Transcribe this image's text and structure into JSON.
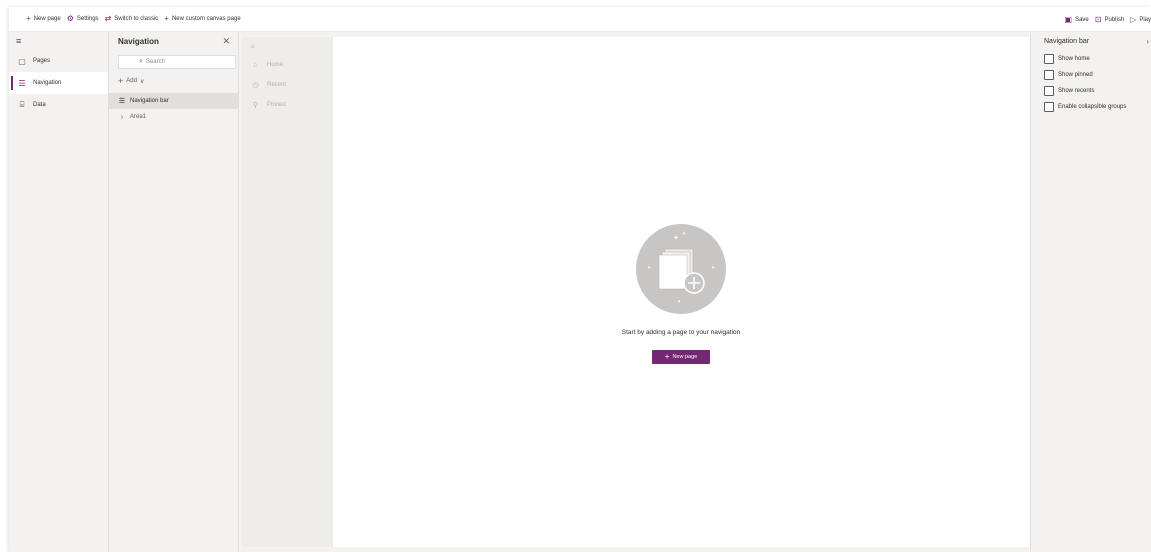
{
  "command_bar": {
    "new_page": "New page",
    "settings": "Settings",
    "switch_to_classic": "Switch to classic",
    "new_custom_canvas_page": "New custom canvas page",
    "save": "Save",
    "publish": "Publish",
    "play": "Play"
  },
  "rail": {
    "items": [
      {
        "label": "Pages",
        "icon": "page-icon"
      },
      {
        "label": "Navigation",
        "icon": "navigation-icon",
        "active": true
      },
      {
        "label": "Data",
        "icon": "database-icon"
      }
    ]
  },
  "nav_panel": {
    "title": "Navigation",
    "search_placeholder": "Search",
    "add_label": "Add",
    "items": [
      {
        "label": "Navigation bar",
        "icon": "list-icon",
        "selected": true
      },
      {
        "label": "Area1",
        "icon": "chevron-right-icon"
      }
    ]
  },
  "preview_nav": {
    "items": [
      {
        "label": "Home",
        "icon": "home-icon"
      },
      {
        "label": "Recent",
        "icon": "clock-icon"
      },
      {
        "label": "Pinned",
        "icon": "pin-icon"
      }
    ]
  },
  "canvas": {
    "empty_message": "Start by adding a page to your navigation",
    "new_page_button": "New page"
  },
  "properties": {
    "title": "Navigation bar",
    "checkboxes": [
      {
        "label": "Show home",
        "checked": false
      },
      {
        "label": "Show pinned",
        "checked": false
      },
      {
        "label": "Show recents",
        "checked": false
      },
      {
        "label": "Enable collapsible groups",
        "checked": false
      }
    ]
  },
  "colors": {
    "accent": "#742774",
    "rail_bg": "#f3f2f1",
    "canvas_bg": "#ffffff"
  }
}
